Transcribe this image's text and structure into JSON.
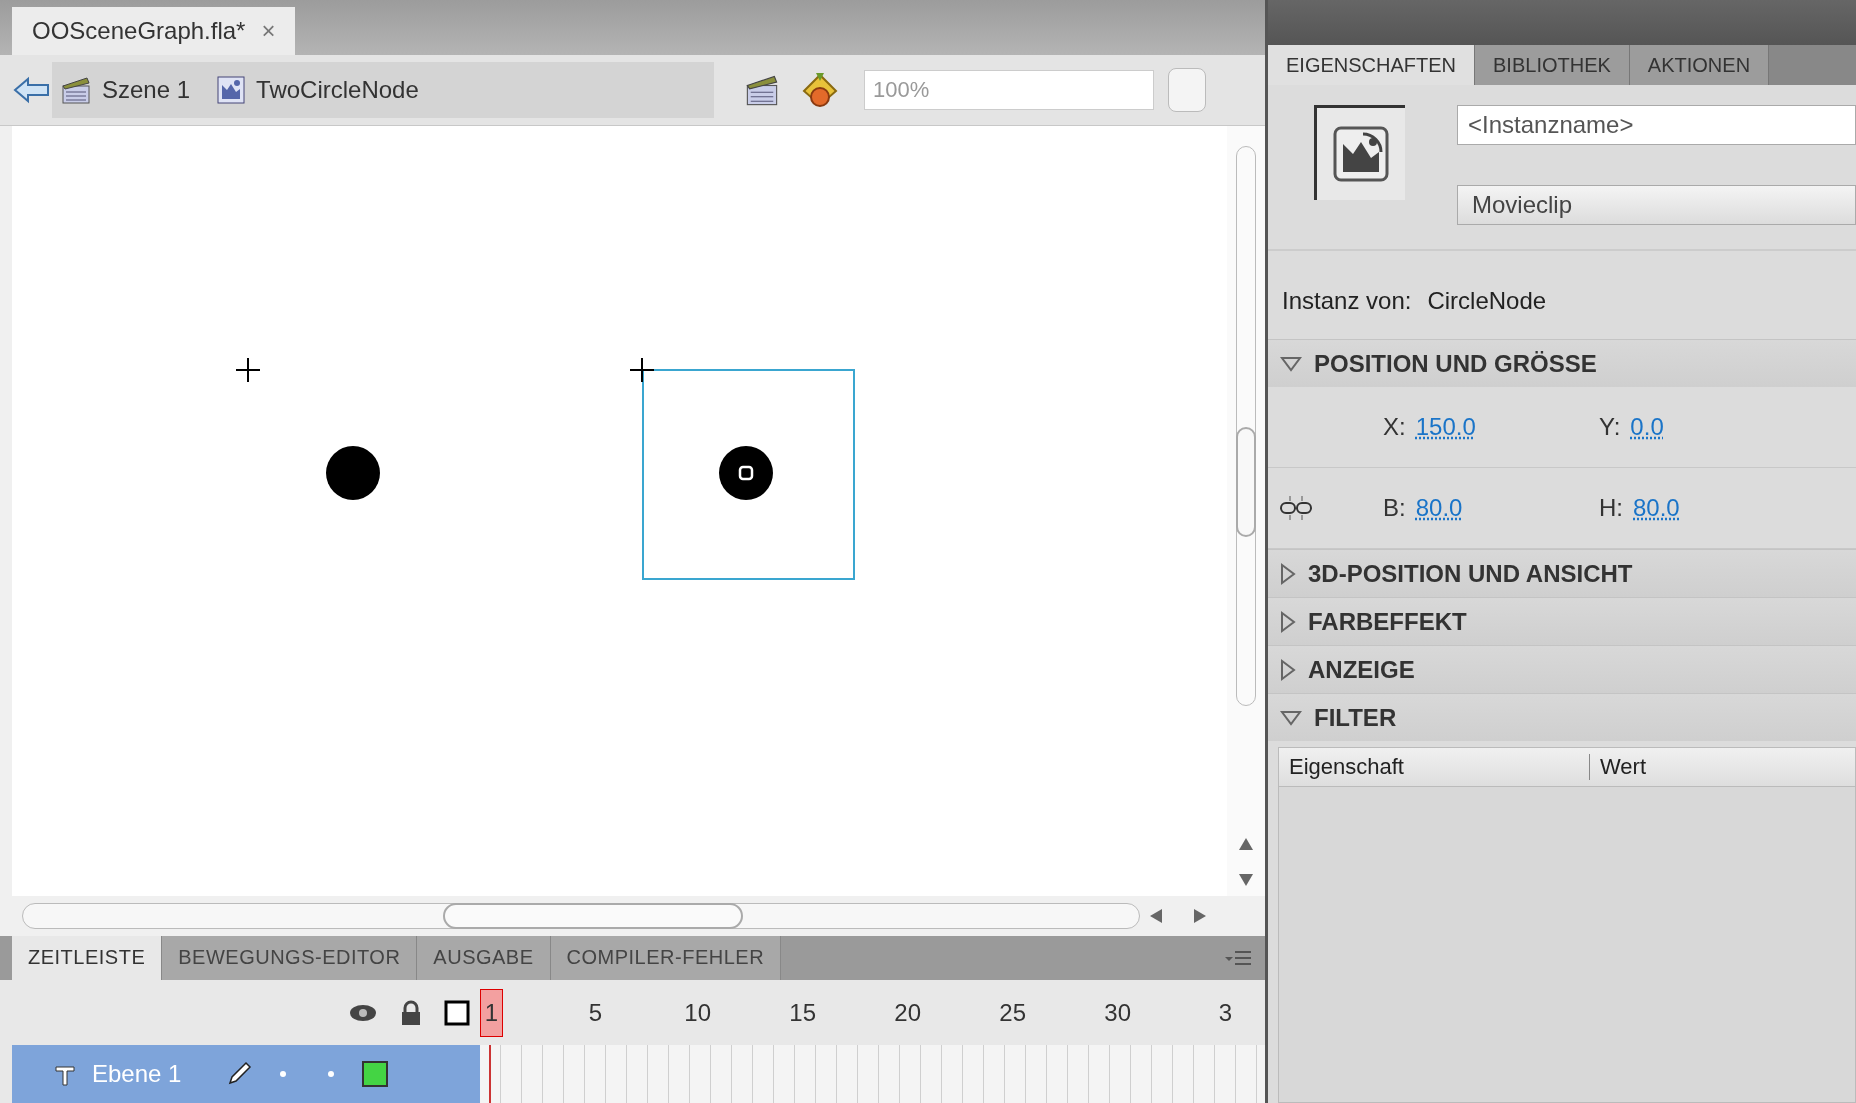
{
  "document_tabs": [
    {
      "label": "OOSceneGraph.fla*",
      "close": "×",
      "selected": true
    }
  ],
  "breadcrumb": [
    {
      "label": "Szene 1",
      "kind": "scene"
    },
    {
      "label": "TwoCircleNode",
      "kind": "symbol"
    }
  ],
  "zoom": {
    "value": "100%"
  },
  "stage": {
    "instances": [
      {
        "selected": false
      },
      {
        "selected": true
      }
    ]
  },
  "panel_tabs": [
    {
      "label": "ZEITLEISTE",
      "selected": true
    },
    {
      "label": "BEWEGUNGS-EDITOR",
      "selected": false
    },
    {
      "label": "AUSGABE",
      "selected": false
    },
    {
      "label": "COMPILER-FEHLER",
      "selected": false
    }
  ],
  "timeline": {
    "frames": [
      {
        "label": "1",
        "selected": true
      },
      {
        "label": "5",
        "selected": false
      },
      {
        "label": "10",
        "selected": false
      },
      {
        "label": "15",
        "selected": false
      },
      {
        "label": "20",
        "selected": false
      },
      {
        "label": "25",
        "selected": false
      },
      {
        "label": "30",
        "selected": false
      },
      {
        "label": "3",
        "selected": false
      }
    ],
    "layers": [
      {
        "name": "Ebene 1",
        "selected": true,
        "color": "#44d444"
      }
    ]
  },
  "properties": {
    "tabs": [
      {
        "label": "EIGENSCHAFTEN",
        "selected": true
      },
      {
        "label": "BIBLIOTHEK",
        "selected": false
      },
      {
        "label": "AKTIONEN",
        "selected": false
      }
    ],
    "instance_name": {
      "placeholder": "<Instanzname>"
    },
    "symbol_type": "Movieclip",
    "instance_of_label": "Instanz von:",
    "instance_of": "CircleNode",
    "sections": [
      {
        "title": "POSITION UND GRÖSSE",
        "expanded": true,
        "rows": [
          {
            "kind": "position",
            "fields": [
              {
                "label": "X:",
                "value": "150.0"
              },
              {
                "label": "Y:",
                "value": "0.0"
              }
            ]
          },
          {
            "kind": "size",
            "fields": [
              {
                "label": "B:",
                "value": "80.0"
              },
              {
                "label": "H:",
                "value": "80.0"
              }
            ]
          }
        ]
      },
      {
        "title": "3D-POSITION UND ANSICHT",
        "expanded": false
      },
      {
        "title": "FARBEFFEKT",
        "expanded": false
      },
      {
        "title": "ANZEIGE",
        "expanded": false
      },
      {
        "title": "FILTER",
        "expanded": true,
        "columns": [
          "Eigenschaft",
          "Wert"
        ]
      }
    ]
  }
}
